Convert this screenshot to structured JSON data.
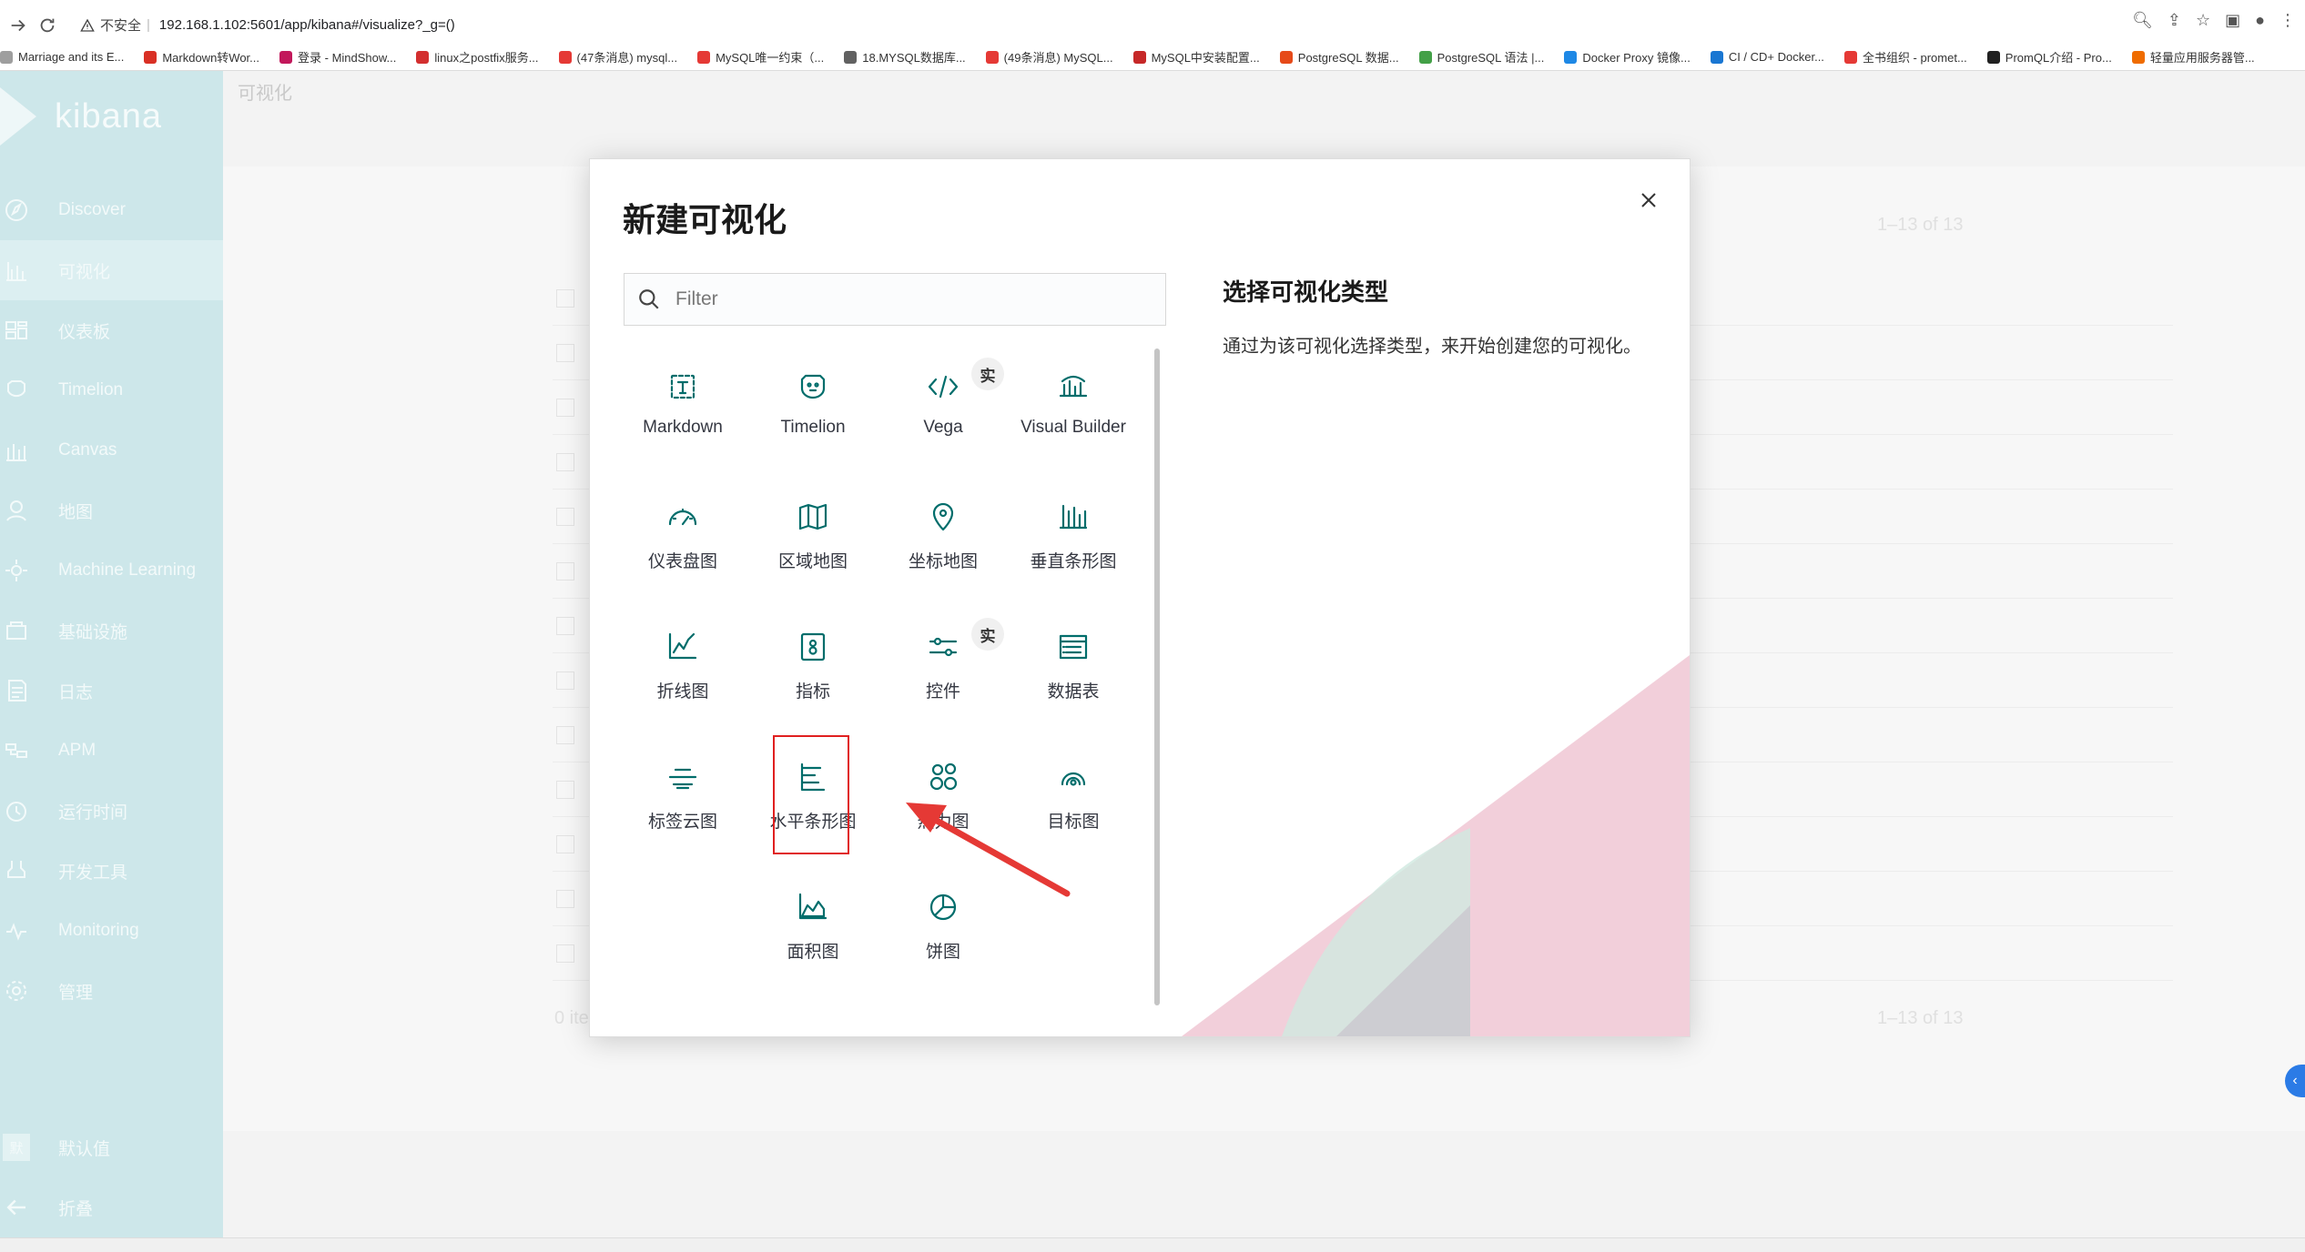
{
  "browser": {
    "security_label": "不安全",
    "url": "192.168.1.102:5601/app/kibana#/visualize?_g=()",
    "bookmarks": [
      {
        "label": "Marriage and its E...",
        "color": "#9e9e9e"
      },
      {
        "label": "Markdown转Wor...",
        "color": "#d93025"
      },
      {
        "label": "登录 - MindShow...",
        "color": "#c2185b"
      },
      {
        "label": "linux之postfix服务...",
        "color": "#d32f2f"
      },
      {
        "label": "(47条消息) mysql...",
        "color": "#e53935"
      },
      {
        "label": "MySQL唯一约束（...",
        "color": "#e53935"
      },
      {
        "label": "18.MYSQL数据库...",
        "color": "#616161"
      },
      {
        "label": "(49条消息) MySQL...",
        "color": "#e53935"
      },
      {
        "label": "MySQL中安装配置...",
        "color": "#c62828"
      },
      {
        "label": "PostgreSQL 数据...",
        "color": "#e64a19"
      },
      {
        "label": "PostgreSQL 语法 |...",
        "color": "#43a047"
      },
      {
        "label": "Docker Proxy 镜像...",
        "color": "#1e88e5"
      },
      {
        "label": "CI / CD+ Docker...",
        "color": "#1976d2"
      },
      {
        "label": "全书组织 - promet...",
        "color": "#e53935"
      },
      {
        "label": "PromQL介绍 - Pro...",
        "color": "#212121"
      },
      {
        "label": "轻量应用服务器管...",
        "color": "#ef6c00"
      }
    ]
  },
  "sidebar": {
    "logo": "kibana",
    "items": [
      {
        "label": "Discover"
      },
      {
        "label": "可视化"
      },
      {
        "label": "仪表板"
      },
      {
        "label": "Timelion"
      },
      {
        "label": "Canvas"
      },
      {
        "label": "地图"
      },
      {
        "label": "Machine Learning"
      },
      {
        "label": "基础设施"
      },
      {
        "label": "日志"
      },
      {
        "label": "APM"
      },
      {
        "label": "运行时间"
      },
      {
        "label": "开发工具"
      },
      {
        "label": "Monitoring"
      },
      {
        "label": "管理"
      }
    ],
    "user_initial": "默",
    "user_label": "默认值",
    "collapse_label": "折叠"
  },
  "main": {
    "title": "可视化",
    "count_top": "1–13 of 13",
    "count_bottom": "1–13 of 13",
    "items_label": "0 ite"
  },
  "modal": {
    "title": "新建可视化",
    "filter_placeholder": "Filter",
    "experimental_badge": "实",
    "tiles": [
      {
        "label": "Markdown",
        "icon": "markdown-icon"
      },
      {
        "label": "Timelion",
        "icon": "timelion-icon"
      },
      {
        "label": "Vega",
        "icon": "vega-icon",
        "experimental": true
      },
      {
        "label": "Visual Builder",
        "icon": "visual-builder-icon"
      },
      {
        "label": "仪表盘图",
        "icon": "gauge-icon"
      },
      {
        "label": "区域地图",
        "icon": "region-map-icon"
      },
      {
        "label": "坐标地图",
        "icon": "coordinate-map-icon"
      },
      {
        "label": "垂直条形图",
        "icon": "vertical-bar-icon"
      },
      {
        "label": "折线图",
        "icon": "line-chart-icon"
      },
      {
        "label": "指标",
        "icon": "metric-icon"
      },
      {
        "label": "控件",
        "icon": "controls-icon",
        "experimental": true
      },
      {
        "label": "数据表",
        "icon": "data-table-icon"
      },
      {
        "label": "标签云图",
        "icon": "tag-cloud-icon"
      },
      {
        "label": "水平条形图",
        "icon": "horizontal-bar-icon",
        "highlighted": true
      },
      {
        "label": "热力图",
        "icon": "heatmap-icon"
      },
      {
        "label": "目标图",
        "icon": "goal-icon"
      },
      {
        "label": "面积图",
        "icon": "area-chart-icon"
      },
      {
        "label": "饼图",
        "icon": "pie-chart-icon"
      }
    ],
    "info_title": "选择可视化类型",
    "info_text": "通过为该可视化选择类型，来开始创建您的可视化。"
  },
  "colors": {
    "sidebar_bg": "#cde7ea",
    "icon_teal": "#006d6b",
    "highlight_red": "#e02020",
    "arrow_red": "#e53935"
  }
}
